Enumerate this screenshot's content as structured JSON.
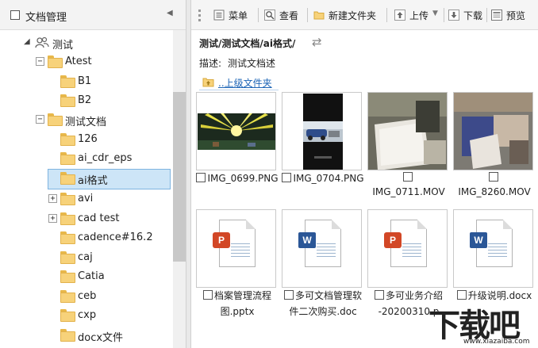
{
  "left_panel": {
    "header_title": "文档管理",
    "tree": [
      {
        "label": "测试",
        "kind": "group",
        "expanded": true
      },
      {
        "label": "Atest",
        "kind": "folder",
        "expanded": true
      },
      {
        "label": "B1",
        "kind": "folder"
      },
      {
        "label": "B2",
        "kind": "folder"
      },
      {
        "label": "测试文档",
        "kind": "folder",
        "expanded": true
      },
      {
        "label": "126",
        "kind": "folder"
      },
      {
        "label": "ai_cdr_eps",
        "kind": "folder"
      },
      {
        "label": "ai格式",
        "kind": "folder",
        "selected": true
      },
      {
        "label": "avi",
        "kind": "folder",
        "collapsed": true
      },
      {
        "label": "cad test",
        "kind": "folder",
        "collapsed": true
      },
      {
        "label": "cadence#16.2",
        "kind": "folder"
      },
      {
        "label": "caj",
        "kind": "folder"
      },
      {
        "label": "Catia",
        "kind": "folder"
      },
      {
        "label": "ceb",
        "kind": "folder"
      },
      {
        "label": "cxp",
        "kind": "folder"
      },
      {
        "label": "docx文件",
        "kind": "folder"
      }
    ]
  },
  "toolbar": {
    "menu": "菜单",
    "view": "查看",
    "new_folder": "新建文件夹",
    "upload": "上传",
    "download": "下载",
    "preview": "预览"
  },
  "content": {
    "path": "测试/测试文档/ai格式/",
    "desc_label": "描述:",
    "desc_value": "测试文档述",
    "up_link": "..上级文件夹",
    "files": [
      {
        "name": "IMG_0699.PNG",
        "type": "image"
      },
      {
        "name": "IMG_0704.PNG",
        "type": "image"
      },
      {
        "name": "IMG_0711.MOV",
        "type": "video"
      },
      {
        "name": "IMG_8260.MOV",
        "type": "video"
      },
      {
        "name_line1": "档案管理流程",
        "name_line2": "图.pptx",
        "type": "pptx"
      },
      {
        "name_line1": "多可文档管理软",
        "name_line2": "件二次购买.doc",
        "type": "doc"
      },
      {
        "name_line1": "多可业务介绍",
        "name_line2": "-20200310.p",
        "type": "pptx"
      },
      {
        "name_line1": "升级说明.docx",
        "name_line2": "",
        "type": "docx"
      }
    ]
  },
  "watermark": {
    "text": "下载吧",
    "url": "www.xiazaiba.com"
  },
  "colors": {
    "selection": "#cde5f7",
    "link": "#1c64b6",
    "folder": "#f7d27a"
  }
}
